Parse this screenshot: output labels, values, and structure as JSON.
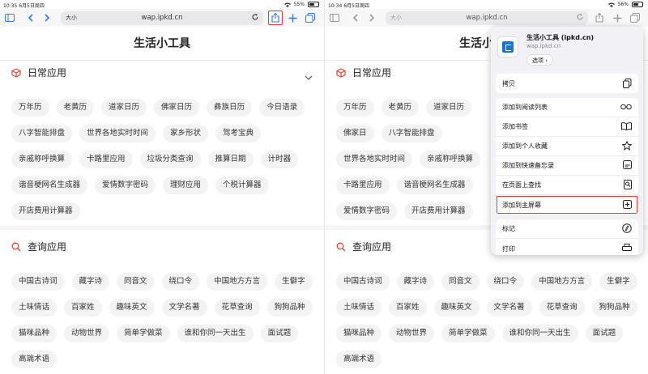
{
  "left": {
    "status": {
      "time": "10:35",
      "date": "6月5日周四",
      "battery": "55%"
    },
    "url": {
      "aa": "大小",
      "host": "wap.ipkd.cn"
    },
    "page_title": "生活小工具",
    "daily": {
      "title": "日常应用",
      "items": [
        "万年历",
        "老黄历",
        "道家日历",
        "佛家日历",
        "彝族日历",
        "今日语录",
        "八字智能排盘",
        "世界各地实时时间",
        "家乡形状",
        "驾考宝典",
        "亲戚称呼换算",
        "卡路里应用",
        "垃圾分类查询",
        "推算日期",
        "计时器",
        "谐音梗网名生成器",
        "爱情数字密码",
        "理财应用",
        "个税计算器",
        "开店费用计算器"
      ]
    },
    "query": {
      "title": "查询应用",
      "items": [
        "中国古诗词",
        "藏字诗",
        "同音文",
        "绕口令",
        "中国地方方言",
        "生僻字",
        "土味情话",
        "百家姓",
        "趣味英文",
        "文学名著",
        "花草查询",
        "狗狗品种",
        "猫咪品种",
        "动物世界",
        "简单学做菜",
        "谁和你同一天出生",
        "面试题",
        "高端术语"
      ]
    }
  },
  "right": {
    "status": {
      "time": "10:34",
      "date": "6月5日周四",
      "battery": "56%"
    },
    "url": {
      "aa": "大小",
      "host": "wap.ipkd.cn"
    },
    "page_title": "生活小",
    "daily": {
      "title": "日常应用",
      "items": [
        "万年历",
        "老黄历",
        "道家日历",
        "佛家日",
        "八字智能排盘",
        "世界各地实时时间",
        "亲戚称呼换算",
        "卡路里应用",
        "谐音梗网名生成器",
        "爱情数字密码",
        "开店费用计算器"
      ]
    },
    "query": {
      "title": "查询应用",
      "items": [
        "中国古诗词",
        "藏字诗",
        "同音文",
        "绕口令",
        "中国地方方言",
        "生僻字",
        "土味情话",
        "百家姓",
        "趣味英文",
        "文学名著",
        "花草查询",
        "狗狗品种",
        "猫咪品种",
        "动物世界",
        "简单学做菜",
        "谁和你同一天出生",
        "面试题",
        "高端术语"
      ]
    },
    "share_sheet": {
      "site_title": "生活小工具 (ipkd.cn)",
      "site_url": "wap.ipkd.cn",
      "options": "选项 ›",
      "copy": "拷贝",
      "actions": [
        "添加到阅读列表",
        "添加书签",
        "添加到个人收藏",
        "添加到快速备忘录",
        "在页面上查找",
        "添加到主屏幕"
      ],
      "more": [
        "标记",
        "打印"
      ]
    }
  },
  "colors": {
    "accent": "#2f7bf5",
    "highlight": "#e53935",
    "section_icon": "#e8473a"
  }
}
